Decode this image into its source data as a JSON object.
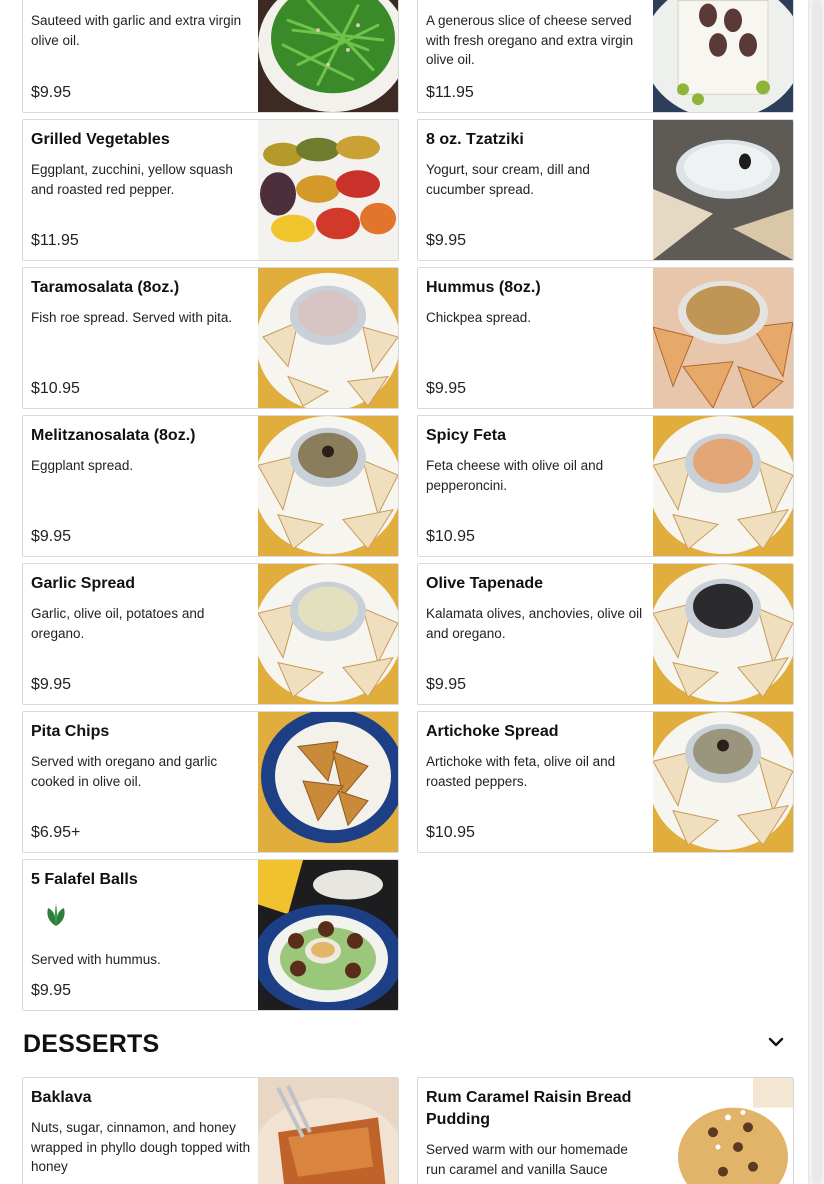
{
  "menu": {
    "items": [
      {
        "name": "",
        "desc": "Sauteed with garlic and extra virgin olive oil.",
        "price": "$9.95"
      },
      {
        "name": "",
        "desc": "A generous slice of cheese served with fresh oregano and extra virgin olive oil.",
        "price": "$11.95"
      },
      {
        "name": "Grilled Vegetables",
        "desc": "Eggplant, zucchini, yellow squash and roasted red pepper.",
        "price": "$11.95"
      },
      {
        "name": "8 oz. Tzatziki",
        "desc": "Yogurt, sour cream, dill and cucumber spread.",
        "price": "$9.95"
      },
      {
        "name": "Taramosalata (8oz.)",
        "desc": "Fish roe spread. Served with pita.",
        "price": "$10.95"
      },
      {
        "name": "Hummus (8oz.)",
        "desc": "Chickpea spread.",
        "price": "$9.95"
      },
      {
        "name": "Melitzanosalata (8oz.)",
        "desc": "Eggplant spread.",
        "price": "$9.95"
      },
      {
        "name": "Spicy Feta",
        "desc": "Feta cheese with olive oil and pepperoncini.",
        "price": "$10.95"
      },
      {
        "name": "Garlic Spread",
        "desc": "Garlic, olive oil, potatoes and oregano.",
        "price": "$9.95"
      },
      {
        "name": "Olive Tapenade",
        "desc": "Kalamata olives, anchovies, olive oil and oregano.",
        "price": "$9.95"
      },
      {
        "name": "Pita Chips",
        "desc": "Served with oregano and garlic cooked in olive oil.",
        "price": "$6.95+"
      },
      {
        "name": "Artichoke Spread",
        "desc": "Artichoke with feta, olive oil and roasted peppers.",
        "price": "$10.95"
      },
      {
        "name": "5 Falafel Balls",
        "desc": "Served with hummus.",
        "price": "$9.95",
        "badge_icon": "vegan-leaf-icon"
      }
    ]
  },
  "desserts": {
    "title": "DESSERTS",
    "toggle_icon": "chevron-down-icon",
    "items": [
      {
        "name": "Baklava",
        "desc": "Nuts, sugar, cinnamon, and honey wrapped in phyllo dough topped with honey"
      },
      {
        "name": "Rum Caramel Raisin Bread Pudding",
        "desc": "Served warm with our homemade run caramel and vanilla Sauce"
      }
    ]
  },
  "colors": {
    "card_border": "#d9d9d9",
    "leaf_green": "#2f7d3a",
    "table_yellow": "#e1ad3c",
    "plate_blue": "#1d3f86"
  }
}
